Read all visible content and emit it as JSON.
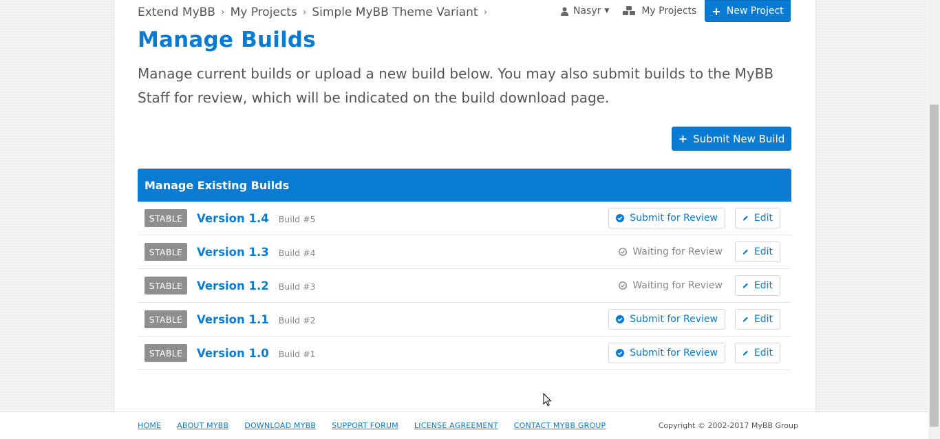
{
  "breadcrumbs": [
    "Extend MyBB",
    "My Projects",
    "Simple MyBB Theme Variant"
  ],
  "breadcrumb_separator": "›",
  "user": {
    "name": "Nasyr"
  },
  "nav": {
    "my_projects": "My Projects",
    "new_project": "New Project"
  },
  "page": {
    "title": "Manage Builds",
    "description": "Manage current builds or upload a new build below. You may also submit builds to the MyBB Staff for review, which will be indicated on the build download page.",
    "submit_new_build": "Submit New Build"
  },
  "panel": {
    "title": "Manage Existing Builds"
  },
  "builds": [
    {
      "badge": "STABLE",
      "version": "Version 1.4",
      "build": "Build #5",
      "status": "Submit for Review",
      "edit": "Edit"
    },
    {
      "badge": "STABLE",
      "version": "Version 1.3",
      "build": "Build #4",
      "status": "Waiting for Review",
      "edit": "Edit"
    },
    {
      "badge": "STABLE",
      "version": "Version 1.2",
      "build": "Build #3",
      "status": "Waiting for Review",
      "edit": "Edit"
    },
    {
      "badge": "STABLE",
      "version": "Version 1.1",
      "build": "Build #2",
      "status": "Submit for Review",
      "edit": "Edit"
    },
    {
      "badge": "STABLE",
      "version": "Version 1.0",
      "build": "Build #1",
      "status": "Submit for Review",
      "edit": "Edit"
    }
  ],
  "footer": {
    "links": [
      "HOME",
      "ABOUT MYBB",
      "DOWNLOAD MYBB",
      "SUPPORT FORUM",
      "LICENSE AGREEMENT",
      "CONTACT MYBB GROUP"
    ],
    "copyright": "Copyright © 2002-2017 MyBB Group"
  },
  "colors": {
    "accent": "#0a7bd3",
    "badge": "#8f8f8f"
  }
}
